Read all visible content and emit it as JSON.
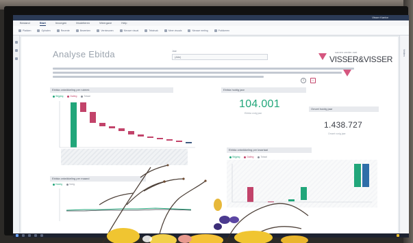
{
  "window": {
    "user_name": "Visser Kantor",
    "ribbon_tabs": [
      "Bestand",
      "Start",
      "Invoegen",
      "Modelleren",
      "Weergave",
      "Help"
    ],
    "active_tab": "Start",
    "ribbon_buttons": [
      "Plakken",
      "Ophalen",
      "Recente",
      "Bewerken",
      "Vernieuwen",
      "Nieuwe visual",
      "Tekstvak",
      "Meer visuals",
      "Nieuwe meting",
      "Publiceren"
    ]
  },
  "report": {
    "title": "Analyse Ebitda",
    "filter": {
      "label": "Jaar",
      "value": "(Alle)"
    },
    "logo": {
      "tagline": "samen verder met",
      "name": "VISSER&VISSER"
    },
    "waterfall": {
      "title": "Ebitda ontwikkeling per rubriek",
      "legend": [
        "Stijging",
        "Daling",
        "Totaal"
      ]
    },
    "kpi1": {
      "title": "Ebitda huidig jaar",
      "value": "104.001",
      "subtitle": "Ebitda vorig jaar"
    },
    "kpi2": {
      "title": "Omzet huidig jaar",
      "value": "1.438.727",
      "subtitle": "Omzet vorig jaar"
    },
    "line_chart": {
      "title": "Ebitda ontwikkeling per maand",
      "legend": [
        "Huidig",
        "Vorig"
      ]
    },
    "waterfall2": {
      "title": "Ebitda ontwikkeling per kwartaal",
      "legend": [
        "Stijging",
        "Daling",
        "Totaal"
      ]
    }
  },
  "colors": {
    "increase": "#21a67a",
    "decrease": "#c2436a",
    "total": "#2e6ea8",
    "brand_pink": "#d5567f"
  }
}
